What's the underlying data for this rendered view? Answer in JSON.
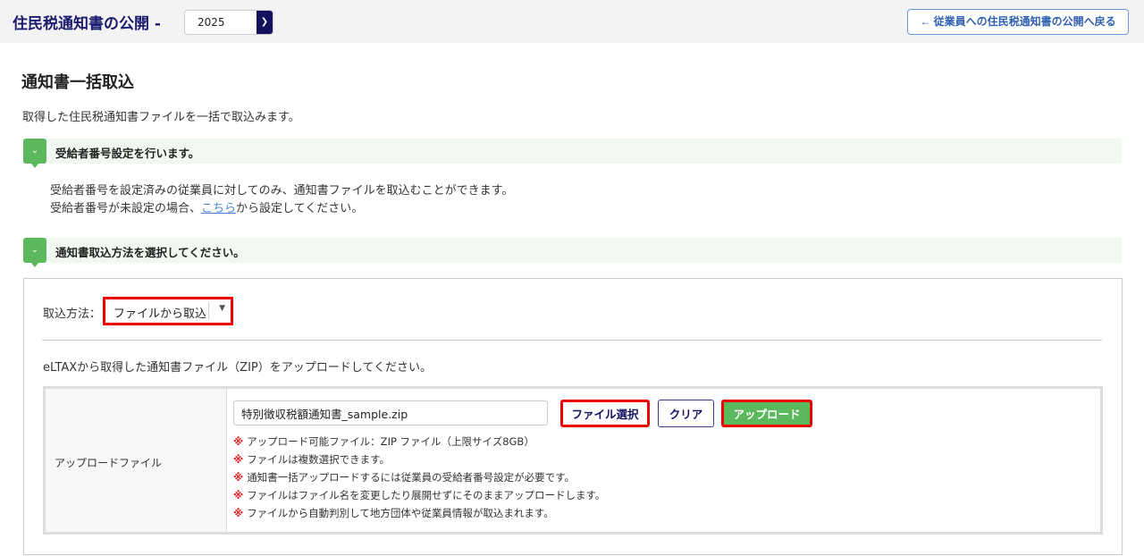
{
  "header": {
    "title": "住民税通知書の公開 -",
    "year": "2025",
    "back_button": "← 従業員への住民税通知書の公開へ戻る"
  },
  "page": {
    "title": "通知書一括取込",
    "description": "取得した住民税通知書ファイルを一括で取込みます。"
  },
  "section1": {
    "title": "受給者番号設定を行います。",
    "line1": "受給者番号を設定済みの従業員に対してのみ、通知書ファイルを取込むことができます。",
    "line2_pre": "受給者番号が未設定の場合、",
    "line2_link": "こちら",
    "line2_post": "から設定してください。"
  },
  "section2": {
    "title": "通知書取込方法を選択してください。"
  },
  "method": {
    "label": "取込方法：",
    "selected": "ファイルから取込"
  },
  "upload": {
    "instruction": "eLTAXから取得した通知書ファイル（ZIP）をアップロードしてください。",
    "row_label": "アップロードファイル",
    "file_value": "特別徴収税額通知書_sample.zip",
    "select_button": "ファイル選択",
    "clear_button": "クリア",
    "upload_button": "アップロード",
    "note_mark": "※",
    "notes": [
      "アップロード可能ファイル：ZIP ファイル（上限サイズ8GB）",
      "ファイルは複数選択できます。",
      "通知書一括アップロードするには従業員の受給者番号設定が必要です。",
      "ファイルはファイル名を変更したり展開せずにそのままアップロードします。",
      "ファイルから自動判別して地方団体や従業員情報が取込まれます。"
    ]
  },
  "colors": {
    "navy": "#12125e",
    "green": "#5cb85c",
    "highlight": "#e00000"
  }
}
